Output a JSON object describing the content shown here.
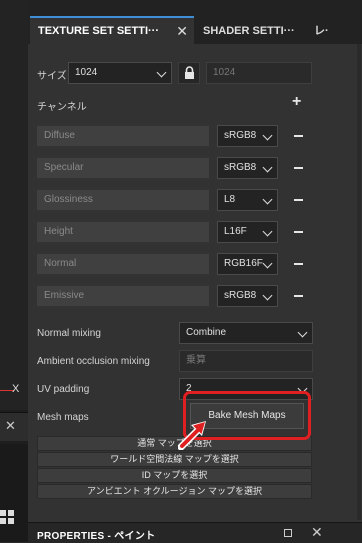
{
  "viewport": {
    "axis_label": "X",
    "close_icon": "✕"
  },
  "tabs": [
    {
      "label": "TEXTURE SET SETTI···",
      "close": "✕"
    },
    {
      "label": "SHADER SETTI···"
    },
    {
      "label": "レ·"
    }
  ],
  "size": {
    "label": "サイズ",
    "value": "1024",
    "linked_value": "1024"
  },
  "channels": {
    "label": "チャンネル",
    "add": "+",
    "items": [
      {
        "name": "Diffuse",
        "format": "sRGB8"
      },
      {
        "name": "Specular",
        "format": "sRGB8"
      },
      {
        "name": "Glossiness",
        "format": "L8"
      },
      {
        "name": "Height",
        "format": "L16F"
      },
      {
        "name": "Normal",
        "format": "RGB16F"
      },
      {
        "name": "Emissive",
        "format": "sRGB8"
      }
    ]
  },
  "normal_mixing": {
    "label": "Normal mixing",
    "value": "Combine"
  },
  "ambient_occlusion_mixing": {
    "label": "Ambient occlusion mixing",
    "value": "乗算"
  },
  "uv_padding": {
    "label": "UV padding",
    "value": "2"
  },
  "mesh_maps": {
    "label": "Mesh maps",
    "bake_label": "Bake Mesh Maps",
    "buttons": [
      "通常 マップを選択",
      "ワールド空間法線 マップを選択",
      "ID マップを選択",
      "アンビエント オクルージョン マップを選択"
    ]
  },
  "properties": {
    "title": "PROPERTIES - ペイント"
  },
  "colors": {
    "accent": "#3f8fd8",
    "highlight": "#e02020"
  }
}
